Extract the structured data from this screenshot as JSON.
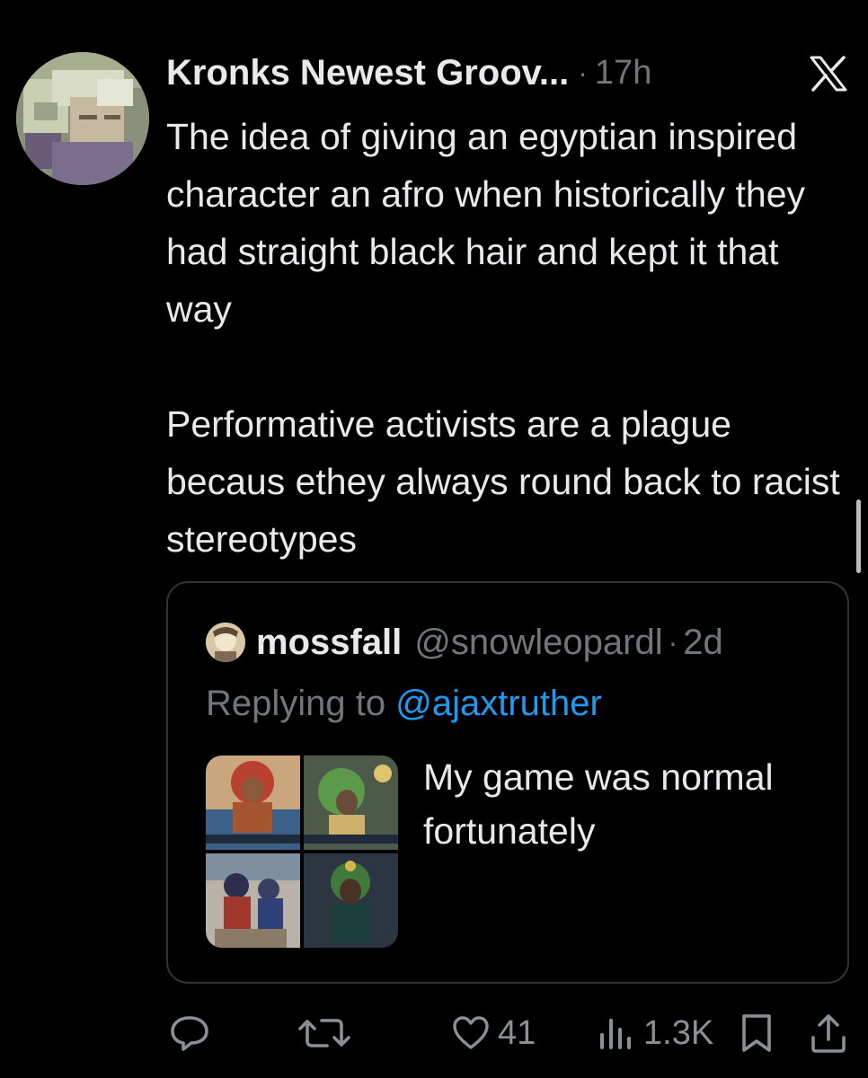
{
  "tweet": {
    "author_name": "Kronks Newest Groov...",
    "separator": "·",
    "time": "17h",
    "paragraphs": [
      "The idea of giving an egyptian inspired character an afro when historically they had straight black hair and kept it that way",
      "Performative activists are a plague becaus ethey always round back to racist stereotypes"
    ]
  },
  "quote": {
    "name": "mossfall",
    "handle": "@snowleopardl",
    "separator": "·",
    "time": "2d",
    "replying_prefix": "Replying to",
    "replying_to": "@ajaxtruther",
    "text": "My game was normal fortunately",
    "media_count": 4
  },
  "actions": {
    "reply_icon": "reply-icon",
    "retweet_icon": "retweet-icon",
    "like_count": "41",
    "views_count": "1.3K",
    "bookmark_icon": "bookmark-icon",
    "share_icon": "share-icon"
  },
  "colors": {
    "background": "#000000",
    "text": "#e7e9ea",
    "muted": "#71767b",
    "link": "#1d9bf0",
    "border": "#2f3336"
  }
}
